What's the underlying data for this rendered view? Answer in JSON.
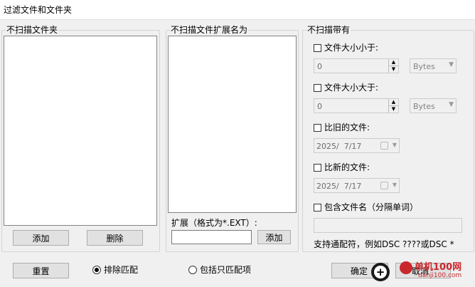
{
  "window": {
    "title": "过滤文件和文件夹"
  },
  "folders_group": {
    "legend": "不扫描文件夹",
    "add_label": "添加",
    "delete_label": "删除"
  },
  "ext_group": {
    "legend": "不扫描文件扩展名为",
    "ext_label": "扩展（格式为*.EXT）:",
    "ext_value": "",
    "add_label": "添加"
  },
  "criteria_group": {
    "legend": "不扫描带有",
    "size_less": {
      "label": "文件大小小于:",
      "value": "0",
      "unit": "Bytes",
      "checked": false
    },
    "size_greater": {
      "label": "文件大小大于:",
      "value": "0",
      "unit": "Bytes",
      "checked": false
    },
    "older": {
      "label": "比旧的文件:",
      "date": "2025/  7/17",
      "checked": false
    },
    "newer": {
      "label": "比新的文件:",
      "date": "2025/  7/17",
      "checked": false
    },
    "name_contains": {
      "label": "包含文件名（分隔单词）",
      "value": "",
      "checked": false
    },
    "hint": "支持通配符，例如DSC ????或DSC *"
  },
  "footer": {
    "reset_label": "重置",
    "radio_exclude": "排除匹配",
    "radio_include_only": "包括只匹配项",
    "selected": "exclude",
    "ok_label": "确定",
    "cancel_label": "取消"
  },
  "watermark": {
    "line1": "单机100网",
    "line2": "danji100.com"
  }
}
